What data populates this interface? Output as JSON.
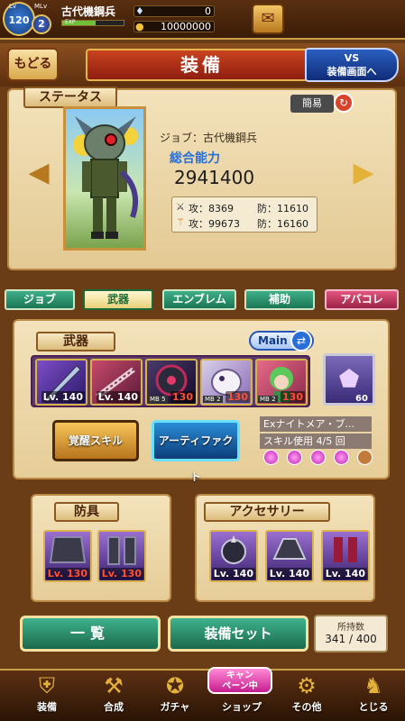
{
  "topbar": {
    "lv_small": "Lv",
    "level": "120",
    "mlv_small": "MLv",
    "master_level": "2",
    "player_name": "古代機鋼兵",
    "exp_label": "EXP",
    "exp_fraction": 0.55,
    "gems": "0",
    "coins": "10000000"
  },
  "header": {
    "back_label": "もどる",
    "title": "装備",
    "vs_label_1": "VS",
    "vs_label_2": "装備画面へ"
  },
  "status": {
    "section_label": "ステータス",
    "simple_label": "簡易",
    "job_line": "ジョブ：古代機鋼兵",
    "total_label": "総合能力",
    "total_value": "2941400",
    "atk1": "攻：8369",
    "def1": "防：11610",
    "atk2": "攻：99673",
    "def2": "防：16160"
  },
  "tabs": [
    "ジョブ",
    "武器",
    "エンブレム",
    "補助",
    "アバコレ"
  ],
  "weapons": {
    "section_label": "武器",
    "main_label": "Main",
    "slots": [
      {
        "lv": "Lv. 140",
        "mb": ""
      },
      {
        "lv": "Lv. 140",
        "mb": ""
      },
      {
        "lv": "130",
        "mb": "MB 5"
      },
      {
        "lv": "130",
        "mb": "MB 2"
      },
      {
        "lv": "130",
        "mb": "MB 2"
      }
    ],
    "sub_count": "60",
    "awaken_label": "覚醒スキル",
    "artifact_label": "アーティファクト",
    "ex_skill": "Exナイトメア・ブ...",
    "skill_use": "スキル使用 4/5 回"
  },
  "armor": {
    "section_label": "防具",
    "slots": [
      "Lv. 130",
      "Lv. 130"
    ]
  },
  "accessory": {
    "section_label": "アクセサリー",
    "slots": [
      "Lv. 140",
      "Lv. 140",
      "Lv. 140"
    ]
  },
  "actions": {
    "list_label": "一覧",
    "set_label": "装備セット",
    "owned_label": "所持数",
    "owned_value": "341 / 400"
  },
  "nav": {
    "campaign": "キャン\nペーン中",
    "items": [
      "装備",
      "合成",
      "ガチャ",
      "ショップ",
      "その他",
      "とじる"
    ]
  },
  "colors": {
    "accent_red": "#c9431f",
    "tab_green": "#1b7554",
    "tab_pink": "#9c2245",
    "artifact_blue": "#0c3c78"
  }
}
